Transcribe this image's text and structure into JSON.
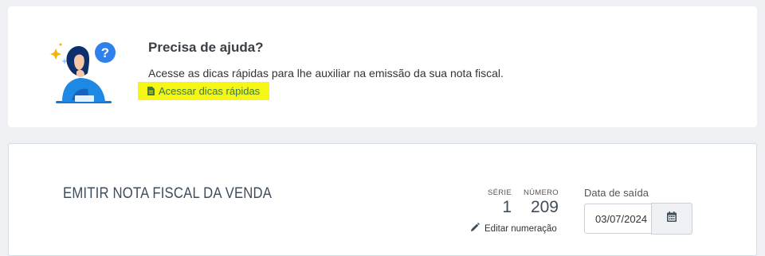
{
  "help": {
    "title": "Precisa de ajuda?",
    "description": "Acesse as dicas rápidas para lhe auxiliar na emissão da sua nota fiscal.",
    "link_label": "Acessar dicas rápidas",
    "illustration_icon": "question-person-illustration",
    "highlight_color": "#f5f516",
    "link_color": "#3c7a46"
  },
  "emit": {
    "title": "EMITIR NOTA FISCAL DA VENDA",
    "serie_label": "SÉRIE",
    "serie_value": "1",
    "numero_label": "NÚMERO",
    "numero_value": "209",
    "edit_label": "Editar numeração",
    "edit_icon": "pencil-icon",
    "date_label": "Data de saída",
    "date_value": "03/07/2024",
    "calendar_icon": "calendar-icon"
  }
}
